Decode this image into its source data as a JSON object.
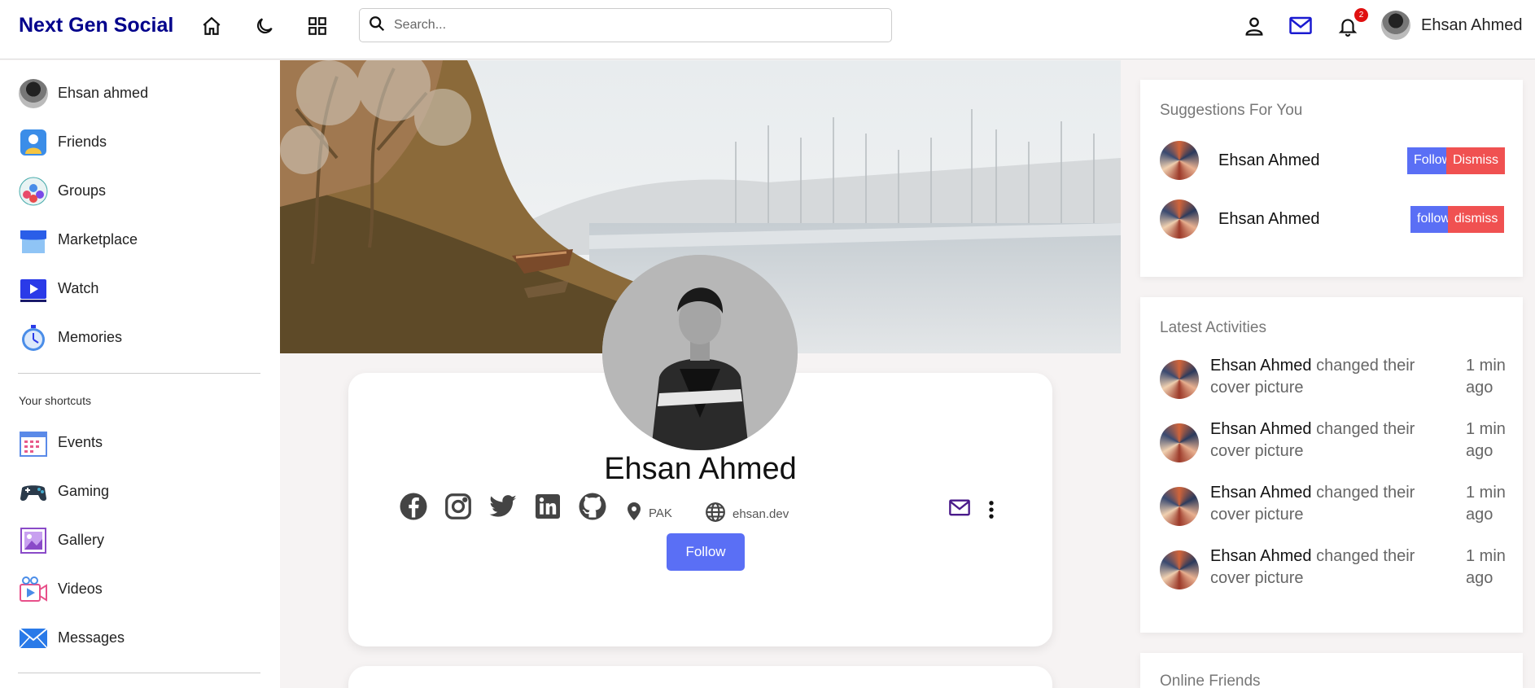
{
  "navbar": {
    "brand": "Next Gen Social",
    "search_placeholder": "Search...",
    "notification_count": "2",
    "user_name": "Ehsan Ahmed",
    "icons": [
      "home-icon",
      "moon-icon",
      "grid-icon",
      "person-icon",
      "mail-icon",
      "bell-icon"
    ]
  },
  "sidebar": {
    "items": [
      {
        "label": "Ehsan ahmed",
        "icon": "user-avatar"
      },
      {
        "label": "Friends",
        "icon": "friends-icon"
      },
      {
        "label": "Groups",
        "icon": "groups-icon"
      },
      {
        "label": "Marketplace",
        "icon": "marketplace-icon"
      },
      {
        "label": "Watch",
        "icon": "watch-icon"
      },
      {
        "label": "Memories",
        "icon": "memories-icon"
      }
    ],
    "shortcuts_title": "Your shortcuts",
    "shortcuts": [
      {
        "label": "Events",
        "icon": "events-icon"
      },
      {
        "label": "Gaming",
        "icon": "gaming-icon"
      },
      {
        "label": "Gallery",
        "icon": "gallery-icon"
      },
      {
        "label": "Videos",
        "icon": "videos-icon"
      },
      {
        "label": "Messages",
        "icon": "messages-icon"
      }
    ]
  },
  "profile": {
    "name": "Ehsan Ahmed",
    "location": "PAK",
    "website": "ehsan.dev",
    "follow_label": "Follow",
    "socials": [
      "facebook-icon",
      "instagram-icon",
      "twitter-icon",
      "linkedin-icon",
      "github-icon"
    ]
  },
  "suggestions": {
    "title": "Suggestions For You",
    "items": [
      {
        "name": "Ehsan Ahmed",
        "follow": "Follow",
        "dismiss": "Dismiss"
      },
      {
        "name": "Ehsan Ahmed",
        "follow": "follow",
        "dismiss": "dismiss"
      }
    ]
  },
  "activities": {
    "title": "Latest Activities",
    "items": [
      {
        "name": "Ehsan Ahmed",
        "action": "changed their cover picture",
        "time": "1 min ago"
      },
      {
        "name": "Ehsan Ahmed",
        "action": "changed their cover picture",
        "time": "1 min ago"
      },
      {
        "name": "Ehsan Ahmed",
        "action": "changed their cover picture",
        "time": "1 min ago"
      },
      {
        "name": "Ehsan Ahmed",
        "action": "changed their cover picture",
        "time": "1 min ago"
      }
    ]
  },
  "online_friends": {
    "title": "Online Friends"
  },
  "colors": {
    "brand": "#00008b",
    "accent": "#5a6ff5",
    "dismiss": "#f05151",
    "badge": "#e01010"
  }
}
